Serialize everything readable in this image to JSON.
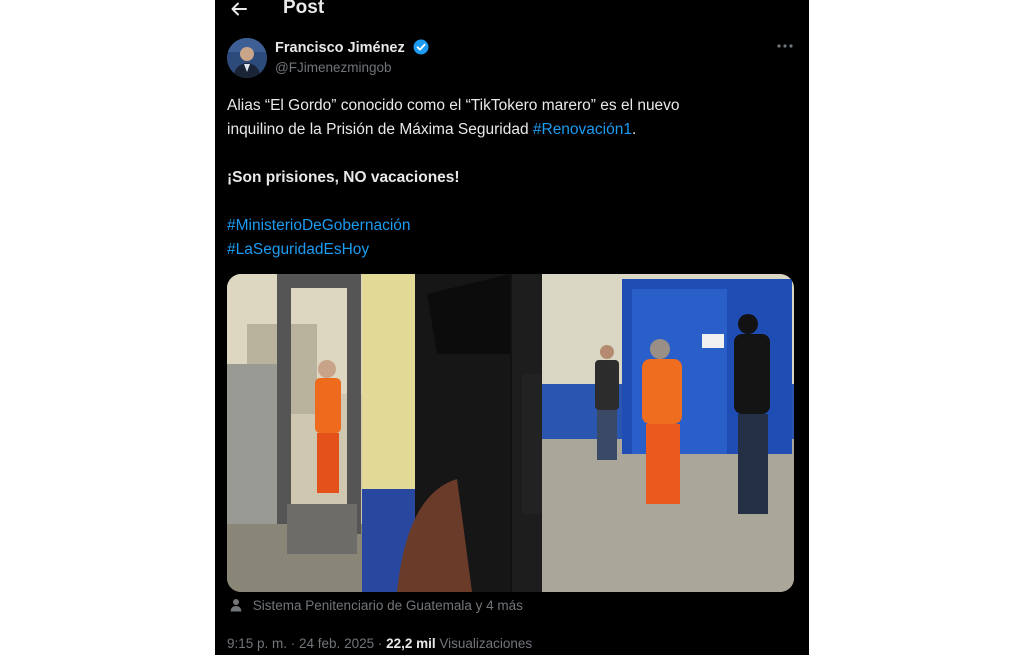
{
  "header": {
    "title": "Post"
  },
  "author": {
    "name": "Francisco Jiménez",
    "handle": "@FJimenezmingob"
  },
  "tweet": {
    "line1": "Alias “El Gordo” conocido como el “TikTokero marero” es el nuevo",
    "line2_text": "inquilino de la Prisión de Máxima Seguridad ",
    "line2_hashtag": "#Renovación1",
    "line2_end": ".",
    "emphasis": "¡Son prisiones, NO vacaciones!",
    "hashtag1": "#MinisterioDeGobernación",
    "hashtag2": "#LaSeguridadEsHoy"
  },
  "media": {
    "photo_left": "photo-prisoner-metal-detector",
    "photo_right": "photo-prisoner-hallway"
  },
  "tags": {
    "text": "Sistema Penitenciario de Guatemala y 4 más"
  },
  "meta": {
    "time_date": "9:15 p. m. · 24 feb. 2025 · ",
    "views_count": "22,2 mil",
    "views_label": " Visualizaciones"
  },
  "colors": {
    "background": "#000000",
    "text": "#e7e9ea",
    "muted": "#71767b",
    "link": "#1d9bf0",
    "verified": "#1d9bf0"
  },
  "icons": [
    "back-arrow-icon",
    "verified-badge-icon",
    "more-options-icon",
    "person-icon"
  ]
}
